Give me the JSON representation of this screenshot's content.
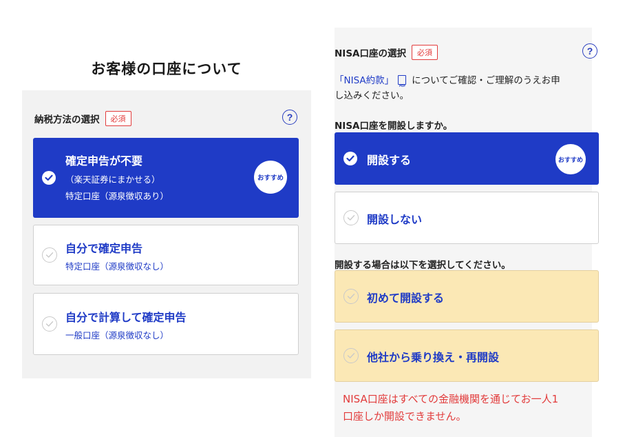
{
  "left": {
    "page_title": "お客様の口座について",
    "section_title": "納税方法の選択",
    "required_badge": "必須",
    "help": "?",
    "options": [
      {
        "title": "確定申告が不要",
        "sub1": "（楽天証券にまかせる）",
        "sub2": "特定口座（源泉徴収あり）",
        "badge": "おすすめ",
        "selected": true
      },
      {
        "title": "自分で確定申告",
        "sub1": "特定口座（源泉徴収なし）",
        "selected": false
      },
      {
        "title": "自分で計算して確定申告",
        "sub1": "一般口座（源泉徴収なし）",
        "selected": false
      }
    ]
  },
  "right": {
    "section_title": "NISA口座の選択",
    "required_badge": "必須",
    "help": "?",
    "notice_link": "「NISA約款」",
    "pdf_label": "PDF",
    "notice_text_1": "についてご確認・ご理解のうえお申",
    "notice_text_2": "し込みください。",
    "question_1": "NISA口座を開設しますか。",
    "open_options": [
      {
        "label": "開設する",
        "badge": "おすすめ",
        "selected": true
      },
      {
        "label": "開設しない",
        "selected": false
      }
    ],
    "question_2": "開設する場合は以下を選択してください。",
    "type_options": [
      {
        "label": "初めて開設する"
      },
      {
        "label": "他社から乗り換え・再開設"
      }
    ],
    "warning_1": "NISA口座はすべての金融機関を通じてお一人1",
    "warning_2": "口座しか開設できません。"
  },
  "colors": {
    "accent": "#1f3bc6",
    "required": "#e23b3b",
    "warning": "#e23b3b",
    "option_yellow": "#fbe8b5",
    "panel_bg": "#f2f2f2"
  }
}
